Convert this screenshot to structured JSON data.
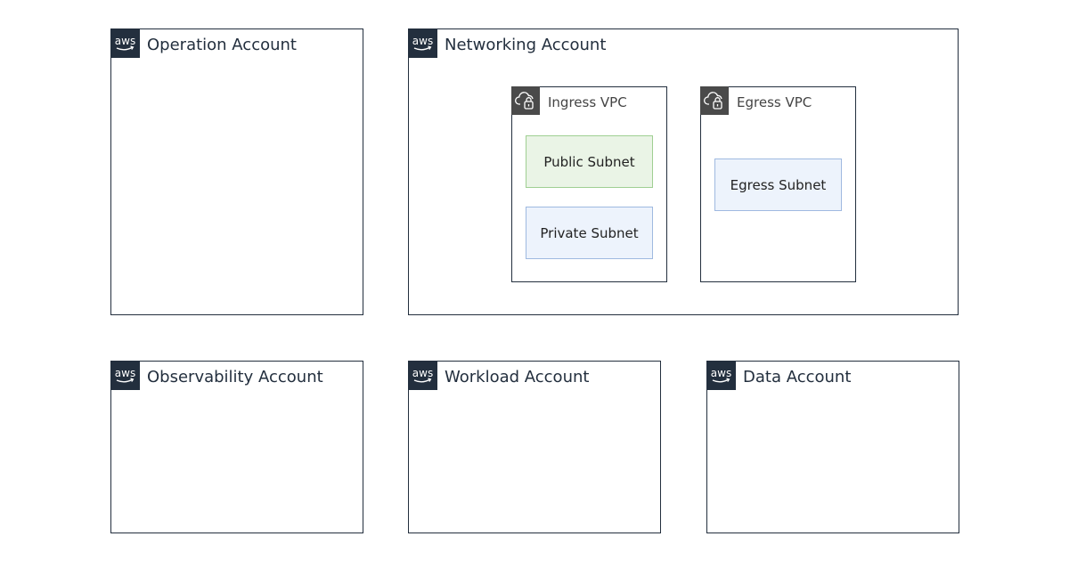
{
  "accounts": {
    "operation": {
      "title": "Operation Account",
      "badge_icon": "aws-logo-icon"
    },
    "networking": {
      "title": "Networking Account",
      "badge_icon": "aws-logo-icon"
    },
    "observability": {
      "title": "Observability Account",
      "badge_icon": "aws-logo-icon"
    },
    "workload": {
      "title": "Workload Account",
      "badge_icon": "aws-logo-icon"
    },
    "data": {
      "title": "Data Account",
      "badge_icon": "aws-logo-icon"
    }
  },
  "vpcs": {
    "ingress": {
      "title": "Ingress VPC",
      "badge_icon": "vpc-cloud-lock-icon",
      "subnets": {
        "public": "Public Subnet",
        "private": "Private Subnet"
      }
    },
    "egress": {
      "title": "Egress VPC",
      "badge_icon": "vpc-cloud-lock-icon",
      "subnets": {
        "egress": "Egress Subnet"
      }
    }
  },
  "colors": {
    "aws_badge": "#232f3e",
    "vpc_badge": "#4a4a4a",
    "public_subnet_fill": "#eaf4e6",
    "public_subnet_border": "#9fcf92",
    "private_subnet_fill": "#edf3fc",
    "private_subnet_border": "#9fb9e0"
  }
}
